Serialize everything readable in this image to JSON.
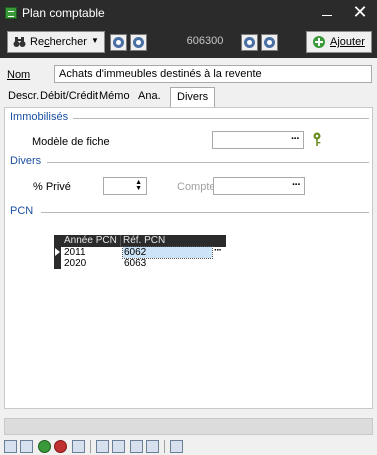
{
  "window": {
    "title": "Plan comptable"
  },
  "toolbar": {
    "search_label": "Rechercher",
    "search_access_key": "c",
    "account_code": "606300",
    "add_label": "Ajouter"
  },
  "record": {
    "nom_label": "Nom",
    "nom_value": "Achats d'immeubles destinés à la revente"
  },
  "tabs": [
    {
      "label": "Descr.",
      "active": false
    },
    {
      "label": "Débit/Crédit",
      "active": false
    },
    {
      "label": "Mémo",
      "active": false
    },
    {
      "label": "Ana.",
      "active": false
    },
    {
      "label": "Divers",
      "active": true
    }
  ],
  "divers_tab": {
    "immobilises": {
      "header": "Immobilisés",
      "modele_label": "Modèle de fiche",
      "modele_value": ""
    },
    "divers": {
      "header": "Divers",
      "prive_label": "% Privé",
      "prive_value": "",
      "compte_label": "Compte",
      "compte_value": ""
    },
    "pcn": {
      "header": "PCN",
      "columns": [
        "Année PCN",
        "Réf. PCN"
      ],
      "rows": [
        {
          "year": "2011",
          "ref": "6062",
          "selected": true
        },
        {
          "year": "2020",
          "ref": "6063",
          "selected": false
        }
      ]
    }
  },
  "colors": {
    "titlebar": "#2b2b2b",
    "section_header": "#1a4fa0",
    "selection": "#cce4f7"
  }
}
